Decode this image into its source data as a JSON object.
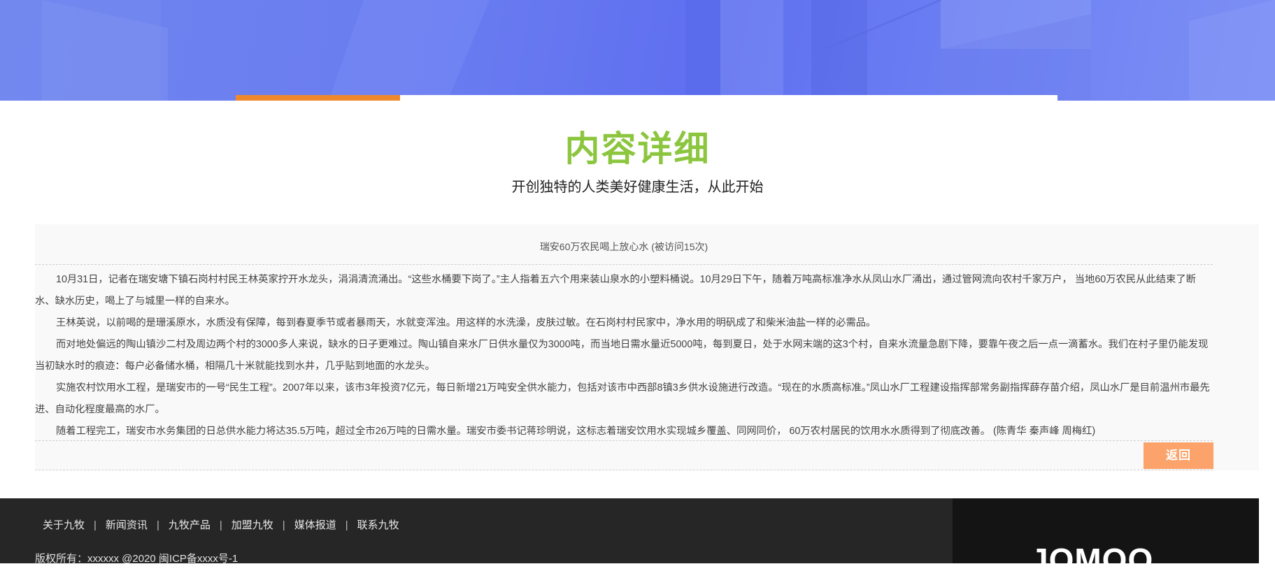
{
  "header": {
    "tabs": [
      "",
      ""
    ]
  },
  "page_heading": {
    "title": "内容详细",
    "subtitle": "开创独特的人类美好健康生活，从此开始"
  },
  "article": {
    "title": "瑞安60万农民喝上放心水 (被访问15次)",
    "paragraphs": [
      "10月31日，记者在瑞安塘下镇石岗村村民王林英家拧开水龙头，涓涓清流涌出。“这些水桶要下岗了。”主人指着五六个用来装山泉水的小塑料桶说。10月29日下午，随着万吨高标准净水从凤山水厂涌出，通过管网流向农村千家万户， 当地60万农民从此结束了断水、缺水历史，喝上了与城里一样的自来水。",
      "王林英说，以前喝的是珊溪原水，水质没有保障，每到春夏季节或者暴雨天，水就变浑浊。用这样的水洗澡，皮肤过敏。在石岗村村民家中，净水用的明矾成了和柴米油盐一样的必需品。",
      "而对地处偏远的陶山镇沙二村及周边两个村的3000多人来说，缺水的日子更难过。陶山镇自来水厂日供水量仅为3000吨，而当地日需水量近5000吨，每到夏日，处于水网末端的这3个村，自来水流量急剧下降，要靠午夜之后一点一滴蓄水。我们在村子里仍能发现当初缺水时的痕迹：每户必备储水桶，相隔几十米就能找到水井，几乎贴到地面的水龙头。",
      "实施农村饮用水工程，是瑞安市的一号“民生工程”。2007年以来，该市3年投资7亿元，每日新增21万吨安全供水能力，包括对该市中西部8镇3乡供水设施进行改造。“现在的水质高标准。”凤山水厂工程建设指挥部常务副指挥薛存苗介绍，凤山水厂是目前温州市最先进、自动化程度最高的水厂。",
      "随着工程完工，瑞安市水务集团的日总供水能力将达35.5万吨，超过全市26万吨的日需水量。瑞安市委书记蒋珍明说，这标志着瑞安饮用水实现城乡覆盖、同网同价， 60万农村居民的饮用水水质得到了彻底改善。 (陈青华 秦声峰 周梅红)"
    ],
    "back_label": "返回"
  },
  "footer": {
    "nav": [
      "关于九牧",
      "新闻资讯",
      "九牧产品",
      "加盟九牧",
      "媒体报道",
      "联系九牧"
    ],
    "separator": "|",
    "copyright": "版权所有：xxxxxx @2020 闽ICP备xxxx号-1",
    "logo_text": "JOMOO"
  },
  "colors": {
    "accent_green": "#8cc63f",
    "tab_orange": "#f0892c",
    "button_orange": "#fba36a",
    "banner_blue": "#6a7cf0",
    "footer_dark": "#262626"
  }
}
